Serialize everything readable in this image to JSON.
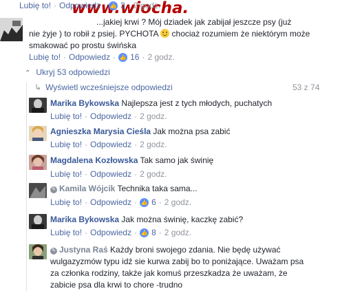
{
  "watermark": "www.wiocha.pl",
  "top_actions": {
    "like": "Lubię to!",
    "reply": "Odpowiedz",
    "reactions": "3",
    "time": "2 godz."
  },
  "main_comment": {
    "text_line1": "...jakiej krwi ? Mój dziadek jak zabijał jeszcze psy (już",
    "text_line2": "nie żyje ) to robił z psiej. PYCHOTA",
    "text_line2b": "chociaż rozumiem że niektórym może",
    "text_line3": "smakować po prostu świńska",
    "like": "Lubię to!",
    "reply": "Odpowiedz",
    "reactions": "16",
    "time": "2 godz."
  },
  "replies_toggle": {
    "label": "Ukryj 53 odpowiedzi"
  },
  "earlier": {
    "label": "Wyświetl wcześniejsze odpowiedzi",
    "count": "53 z 74"
  },
  "replies": [
    {
      "author": "Marika Bykowska",
      "text": "Najlepsza jest z tych młodych, puchatych",
      "like": "Lubię to!",
      "reply": "Odpowiedz",
      "reactions": "",
      "time": "2 godz."
    },
    {
      "author": "Agnieszka Marysia Cieśla",
      "text": "Jak można psa zabić",
      "like": "Lubię to!",
      "reply": "Odpowiedz",
      "reactions": "",
      "time": "2 godz."
    },
    {
      "author": "Magdalena Kozłowska",
      "text": "Tak samo jak świnię",
      "like": "Lubię to!",
      "reply": "Odpowiedz",
      "reactions": "",
      "time": "2 godz."
    },
    {
      "author": "Kamila Wójcik",
      "text": "Technika taka sama...",
      "like": "Lubię to!",
      "reply": "Odpowiedz",
      "reactions": "6",
      "time": "2 godz."
    },
    {
      "author": "Marika Bykowska",
      "text": "Jak można świnię, kaczkę zabić?",
      "like": "Lubię to!",
      "reply": "Odpowiedz",
      "reactions": "8",
      "time": "2 godz."
    },
    {
      "author": "Justyna Raś",
      "text_line1": "Każdy broni swojego zdania. Nie będę używać",
      "text_line2": "wulgazyzmów typu idź sie kurwa zabij bo to poniżające. Uważam psa",
      "text_line3": "za członka rodziny, także jak komuś przeszkadza że uważam, że",
      "text_line4": "zabicie psa dla krwi to chore -trudno"
    }
  ]
}
